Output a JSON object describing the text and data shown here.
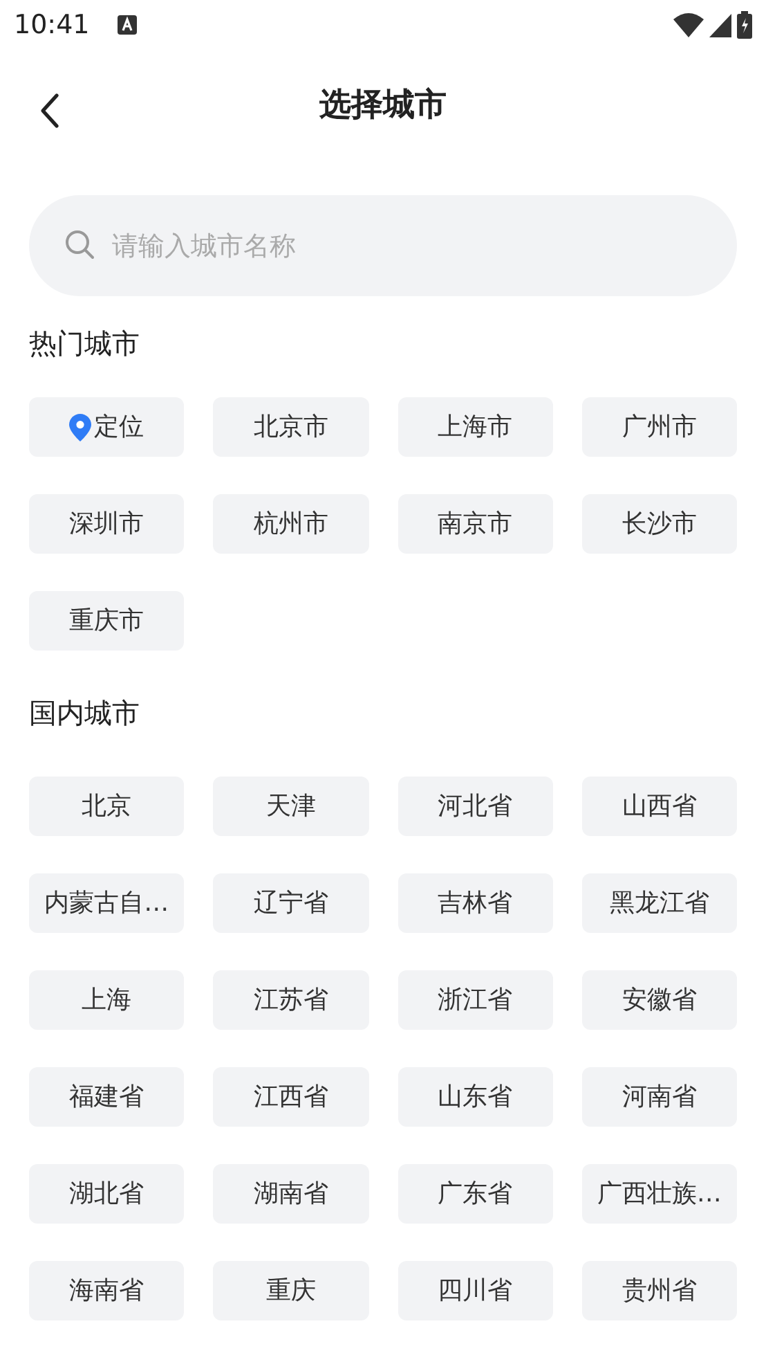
{
  "status_bar": {
    "time": "10:41"
  },
  "header": {
    "title": "选择城市"
  },
  "search": {
    "placeholder": "请输入城市名称"
  },
  "sections": [
    {
      "title": "热门城市",
      "cities": [
        {
          "label": "定位",
          "kind": "location"
        },
        {
          "label": "北京市",
          "kind": "city"
        },
        {
          "label": "上海市",
          "kind": "city"
        },
        {
          "label": "广州市",
          "kind": "city"
        },
        {
          "label": "深圳市",
          "kind": "city"
        },
        {
          "label": "杭州市",
          "kind": "city"
        },
        {
          "label": "南京市",
          "kind": "city"
        },
        {
          "label": "长沙市",
          "kind": "city"
        },
        {
          "label": "重庆市",
          "kind": "city"
        }
      ]
    },
    {
      "title": "国内城市",
      "cities": [
        {
          "label": "北京",
          "kind": "city"
        },
        {
          "label": "天津",
          "kind": "city"
        },
        {
          "label": "河北省",
          "kind": "city"
        },
        {
          "label": "山西省",
          "kind": "city"
        },
        {
          "label": "内蒙古自…",
          "kind": "city"
        },
        {
          "label": "辽宁省",
          "kind": "city"
        },
        {
          "label": "吉林省",
          "kind": "city"
        },
        {
          "label": "黑龙江省",
          "kind": "city"
        },
        {
          "label": "上海",
          "kind": "city"
        },
        {
          "label": "江苏省",
          "kind": "city"
        },
        {
          "label": "浙江省",
          "kind": "city"
        },
        {
          "label": "安徽省",
          "kind": "city"
        },
        {
          "label": "福建省",
          "kind": "city"
        },
        {
          "label": "江西省",
          "kind": "city"
        },
        {
          "label": "山东省",
          "kind": "city"
        },
        {
          "label": "河南省",
          "kind": "city"
        },
        {
          "label": "湖北省",
          "kind": "city"
        },
        {
          "label": "湖南省",
          "kind": "city"
        },
        {
          "label": "广东省",
          "kind": "city"
        },
        {
          "label": "广西壮族…",
          "kind": "city"
        },
        {
          "label": "海南省",
          "kind": "city"
        },
        {
          "label": "重庆",
          "kind": "city"
        },
        {
          "label": "四川省",
          "kind": "city"
        },
        {
          "label": "贵州省",
          "kind": "city"
        }
      ]
    }
  ]
}
